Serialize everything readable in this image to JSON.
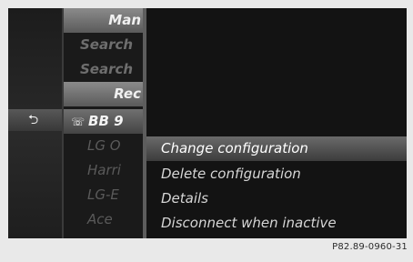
{
  "left_panel": {
    "back_icon": "back-arrow-icon",
    "rows": [
      {
        "label": "Man",
        "kind": "header"
      },
      {
        "label": "Search",
        "kind": "dim"
      },
      {
        "label": "Search",
        "kind": "dim"
      },
      {
        "label": "Rec",
        "kind": "header"
      },
      {
        "label": "BB 9",
        "kind": "selected",
        "icon": "phone-icon"
      },
      {
        "label": "LG O",
        "kind": "device"
      },
      {
        "label": "Harri",
        "kind": "device"
      },
      {
        "label": "LG-E",
        "kind": "device"
      },
      {
        "label": "Ace",
        "kind": "device"
      }
    ]
  },
  "menu": {
    "items": [
      {
        "label": "Change configuration",
        "active": true
      },
      {
        "label": "Delete configuration",
        "active": false
      },
      {
        "label": "Details",
        "active": false
      },
      {
        "label": "Disconnect when inactive",
        "active": false
      }
    ]
  },
  "caption": "P82.89-0960-31"
}
